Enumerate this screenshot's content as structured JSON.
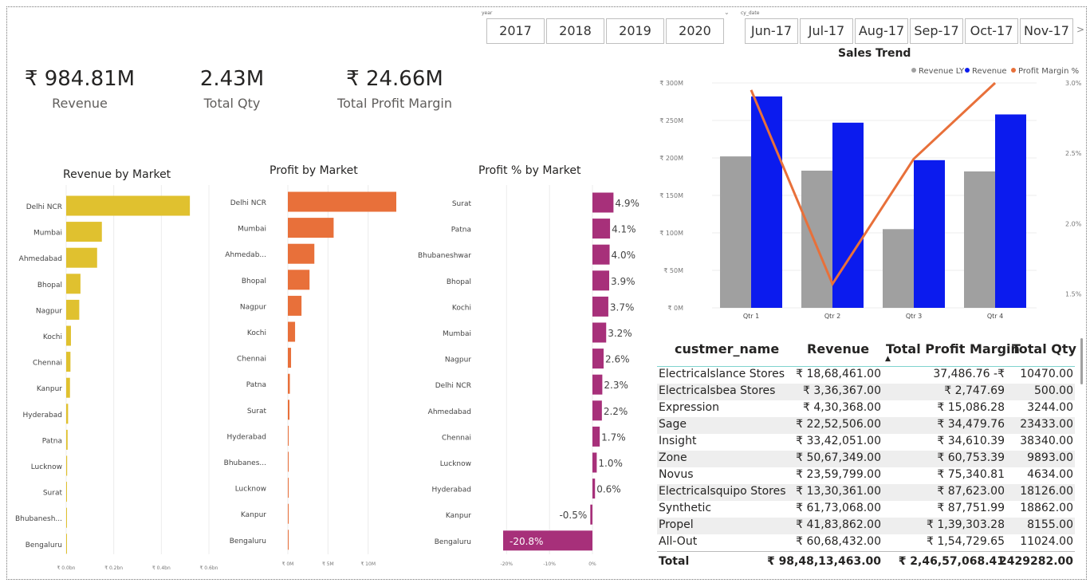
{
  "slicers": {
    "year_title": "year",
    "years": [
      "2017",
      "2018",
      "2019",
      "2020"
    ],
    "date_title": "cy_date",
    "months": [
      "Jun-17",
      "Jul-17",
      "Aug-17",
      "Sep-17",
      "Oct-17",
      "Nov-17"
    ],
    "more_symbol": ">"
  },
  "kpis": [
    {
      "value": "₹ 984.81M",
      "label": "Revenue"
    },
    {
      "value": "2.43M",
      "label": "Total Qty"
    },
    {
      "value": "₹ 24.66M",
      "label": "Total Profit Margin"
    }
  ],
  "chart_data": [
    {
      "type": "bar",
      "orientation": "horizontal",
      "title": "Revenue by Market",
      "categories": [
        "Delhi NCR",
        "Mumbai",
        "Ahmedabad",
        "Bhopal",
        "Nagpur",
        "Kochi",
        "Chennai",
        "Kanpur",
        "Hyderabad",
        "Patna",
        "Lucknow",
        "Surat",
        "Bhubanesh...",
        "Bengaluru"
      ],
      "values": [
        0.52,
        0.15,
        0.13,
        0.06,
        0.055,
        0.02,
        0.018,
        0.016,
        0.008,
        0.006,
        0.004,
        0.003,
        0.002,
        0.001
      ],
      "ticks": [
        "₹ 0.0bn",
        "₹ 0.2bn",
        "₹ 0.4bn",
        "₹ 0.6bn"
      ],
      "xlim": [
        0,
        0.6
      ],
      "color": "#E0C12F",
      "grid": true
    },
    {
      "type": "bar",
      "orientation": "horizontal",
      "title": "Profit by Market",
      "categories": [
        "Delhi NCR",
        "Mumbai",
        "Ahmedab...",
        "Bhopal",
        "Nagpur",
        "Kochi",
        "Chennai",
        "Patna",
        "Surat",
        "Hyderabad",
        "Bhubanes...",
        "Lucknow",
        "Kanpur",
        "Bengaluru"
      ],
      "values": [
        13.5,
        5.7,
        3.3,
        2.7,
        1.7,
        0.9,
        0.4,
        0.25,
        0.2,
        0.1,
        0.08,
        0.06,
        0.04,
        0.03
      ],
      "ticks": [
        "₹ 0M",
        "₹ 5M",
        "₹ 10M"
      ],
      "xlim": [
        0,
        13.5
      ],
      "color": "#E8703A",
      "grid": true
    },
    {
      "type": "bar",
      "orientation": "horizontal",
      "title": "Profit % by Market",
      "categories": [
        "Surat",
        "Patna",
        "Bhubaneshwar",
        "Bhopal",
        "Kochi",
        "Mumbai",
        "Nagpur",
        "Delhi NCR",
        "Ahmedabad",
        "Chennai",
        "Lucknow",
        "Hyderabad",
        "Kanpur",
        "Bengaluru"
      ],
      "values": [
        4.9,
        4.1,
        4.0,
        3.9,
        3.7,
        3.2,
        2.6,
        2.3,
        2.2,
        1.7,
        1.0,
        0.6,
        -0.5,
        -20.8
      ],
      "labels": [
        "4.9%",
        "4.1%",
        "4.0%",
        "3.9%",
        "3.7%",
        "3.2%",
        "2.6%",
        "2.3%",
        "2.2%",
        "1.7%",
        "1.0%",
        "0.6%",
        "-0.5%",
        "-20.8%"
      ],
      "ticks": [
        "-20%",
        "-10%",
        "0%"
      ],
      "xlim": [
        -20.8,
        5
      ],
      "color": "#A7307A",
      "grid": true
    },
    {
      "type": "bar",
      "title": "Sales Trend",
      "categories": [
        "Qtr 1",
        "Qtr 2",
        "Qtr 3",
        "Qtr 4"
      ],
      "series": [
        {
          "name": "Revenue LY",
          "values": [
            202,
            183,
            105,
            182
          ],
          "color": "#A0A0A0"
        },
        {
          "name": "Revenue",
          "values": [
            282,
            247,
            197,
            258
          ],
          "color": "#0B1BEE"
        }
      ],
      "line_series": {
        "name": "Profit Margin %",
        "values": [
          2.95,
          1.57,
          2.46,
          3.0
        ],
        "color": "#E8703A"
      },
      "y_ticks": [
        "₹ 0M",
        "₹ 50M",
        "₹ 100M",
        "₹ 150M",
        "₹ 200M",
        "₹ 250M",
        "₹ 300M"
      ],
      "ylim": [
        0,
        300
      ],
      "y2_ticks": [
        "1.5%",
        "2.0%",
        "2.5%",
        "3.0%"
      ],
      "y2lim": [
        1.4,
        3.0
      ],
      "legend_position": "top-right",
      "grid": true
    }
  ],
  "table": {
    "headers": [
      "custmer_name",
      "Revenue",
      "Total Profit Margin",
      "Total Qty"
    ],
    "sort_indicator": "▲",
    "rows": [
      [
        "Electricalslance Stores",
        "₹ 18,68,461.00",
        "37,486.76 -₹",
        "10470.00"
      ],
      [
        "Electricalsbea Stores",
        "₹ 3,36,367.00",
        "₹ 2,747.69",
        "500.00"
      ],
      [
        "Expression",
        "₹ 4,30,368.00",
        "₹ 15,086.28",
        "3244.00"
      ],
      [
        "Sage",
        "₹ 22,52,506.00",
        "₹ 34,479.76",
        "23433.00"
      ],
      [
        "Insight",
        "₹ 33,42,051.00",
        "₹ 34,610.39",
        "38340.00"
      ],
      [
        "Zone",
        "₹ 50,67,349.00",
        "₹ 60,753.39",
        "9893.00"
      ],
      [
        "Novus",
        "₹ 23,59,799.00",
        "₹ 75,340.81",
        "4634.00"
      ],
      [
        "Electricalsquipo Stores",
        "₹ 13,30,361.00",
        "₹ 87,623.00",
        "18126.00"
      ],
      [
        "Synthetic",
        "₹ 61,73,068.00",
        "₹ 87,751.99",
        "18862.00"
      ],
      [
        "Propel",
        "₹ 41,83,862.00",
        "₹ 1,39,303.28",
        "8155.00"
      ],
      [
        "All-Out",
        "₹ 60,68,432.00",
        "₹ 1,54,729.65",
        "11024.00"
      ]
    ],
    "total": [
      "Total",
      "₹ 98,48,13,463.00",
      "₹ 2,46,57,068.41",
      "2429282.00"
    ]
  }
}
